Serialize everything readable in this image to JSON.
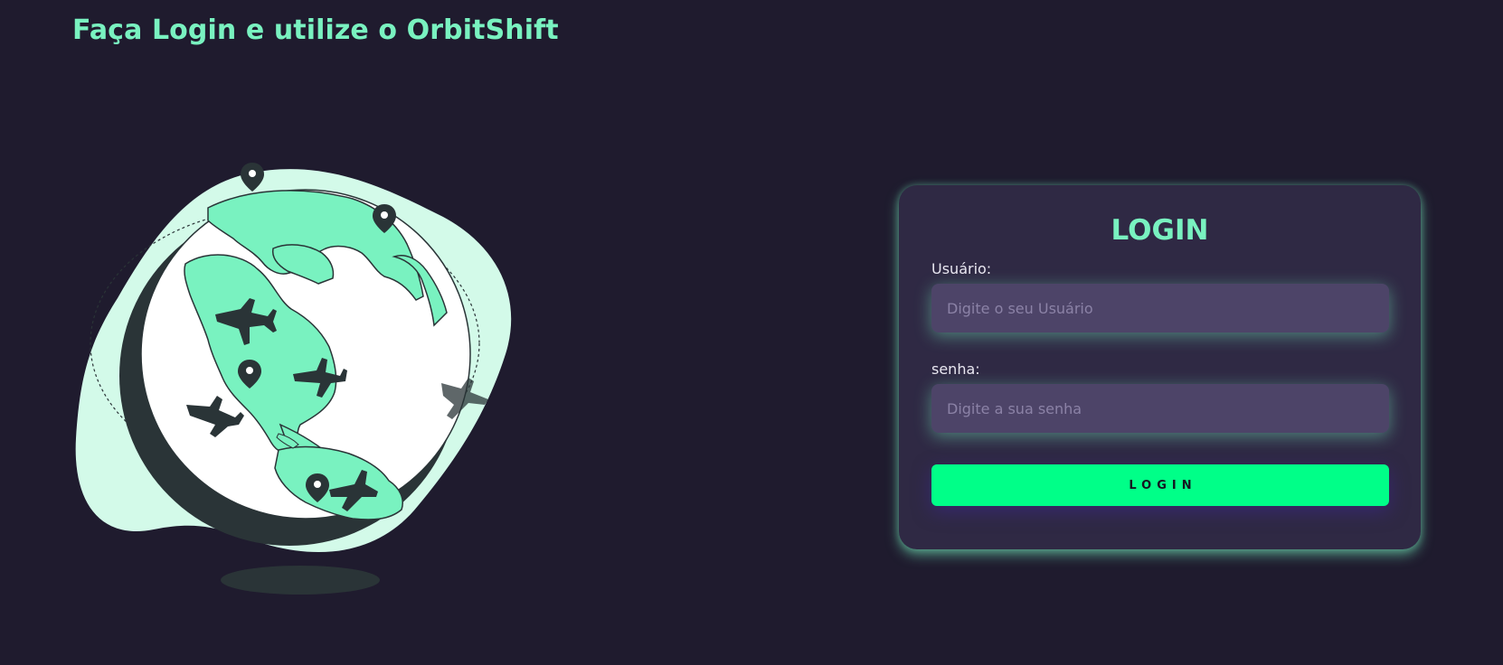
{
  "page": {
    "title": "Faça Login e utilize o OrbitShift"
  },
  "login": {
    "heading": "LOGIN",
    "username_label": "Usuário:",
    "username_placeholder": "Digite o seu Usuário",
    "username_value": "",
    "password_label": "senha:",
    "password_placeholder": "Digite a sua senha",
    "password_value": "",
    "button_label": "LOGIN"
  },
  "illustration": {
    "icon": "globe-travel-illustration"
  },
  "colors": {
    "background": "#1f1b2e",
    "accent": "#79f2c0",
    "card": "#2f2944",
    "input": "#4d4468",
    "button": "#00ff88"
  }
}
